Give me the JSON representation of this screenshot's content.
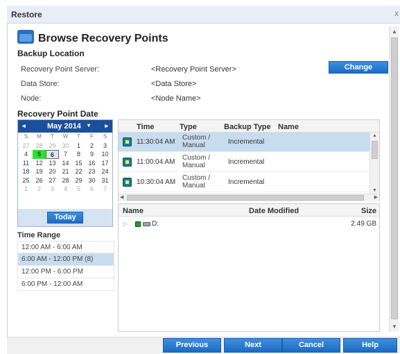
{
  "window": {
    "title": "Restore",
    "close_glyph": "x"
  },
  "header": {
    "title": "Browse Recovery Points",
    "icon": "folder-icon"
  },
  "backup_location": {
    "label": "Backup Location",
    "fields": [
      {
        "label": "Recovery Point Server:",
        "value": "<Recovery Point Server>"
      },
      {
        "label": "Data Store:",
        "value": "<Data Store>"
      },
      {
        "label": "Node:",
        "value": "<Node Name>"
      }
    ],
    "change_button": "Change"
  },
  "recovery_point_date": {
    "label": "Recovery Point Date",
    "calendar": {
      "prev": "◂",
      "next": "▸",
      "month": "May 2014",
      "dropdown": "▾",
      "weekdays": [
        "S",
        "M",
        "T",
        "W",
        "T",
        "F",
        "S"
      ],
      "weeks": [
        [
          "27",
          "28",
          "29",
          "30",
          "1",
          "2",
          "3"
        ],
        [
          "4",
          "5",
          "6",
          "7",
          "8",
          "9",
          "10"
        ],
        [
          "11",
          "12",
          "13",
          "14",
          "15",
          "16",
          "17"
        ],
        [
          "18",
          "19",
          "20",
          "21",
          "22",
          "23",
          "24"
        ],
        [
          "25",
          "26",
          "27",
          "28",
          "29",
          "30",
          "31"
        ],
        [
          "1",
          "2",
          "3",
          "4",
          "5",
          "6",
          "7"
        ]
      ],
      "today_button": "Today"
    }
  },
  "time_range": {
    "label": "Time Range",
    "items": [
      "12:00 AM - 6:00 AM",
      "6:00 AM - 12:00 PM  (8)",
      "12:00 PM - 6:00 PM",
      "6:00 PM - 12:00 AM"
    ]
  },
  "recovery_points": {
    "columns": [
      "Time",
      "Type",
      "Backup Type",
      "Name"
    ],
    "rows": [
      {
        "time": "11:30:04 AM",
        "type": "Custom / Manual",
        "backup_type": "Incremental",
        "name": ""
      },
      {
        "time": "11:00:04 AM",
        "type": "Custom / Manual",
        "backup_type": "Incremental",
        "name": ""
      },
      {
        "time": "10:30:04 AM",
        "type": "Custom / Manual",
        "backup_type": "Incremental",
        "name": ""
      }
    ]
  },
  "file_browser": {
    "columns": [
      "Name",
      "Date Modified",
      "Size"
    ],
    "rows": [
      {
        "expander": "▷",
        "name": "D:",
        "date_modified": "",
        "size": "2.49 GB"
      }
    ]
  },
  "footer": {
    "previous": "Previous",
    "next": "Next",
    "cancel": "Cancel",
    "help": "Help"
  },
  "colors": {
    "accent": "#1d6bc4",
    "calendar_header": "#1c4f9a",
    "available_date": "#33dd33",
    "selection": "#c8dcf0"
  }
}
